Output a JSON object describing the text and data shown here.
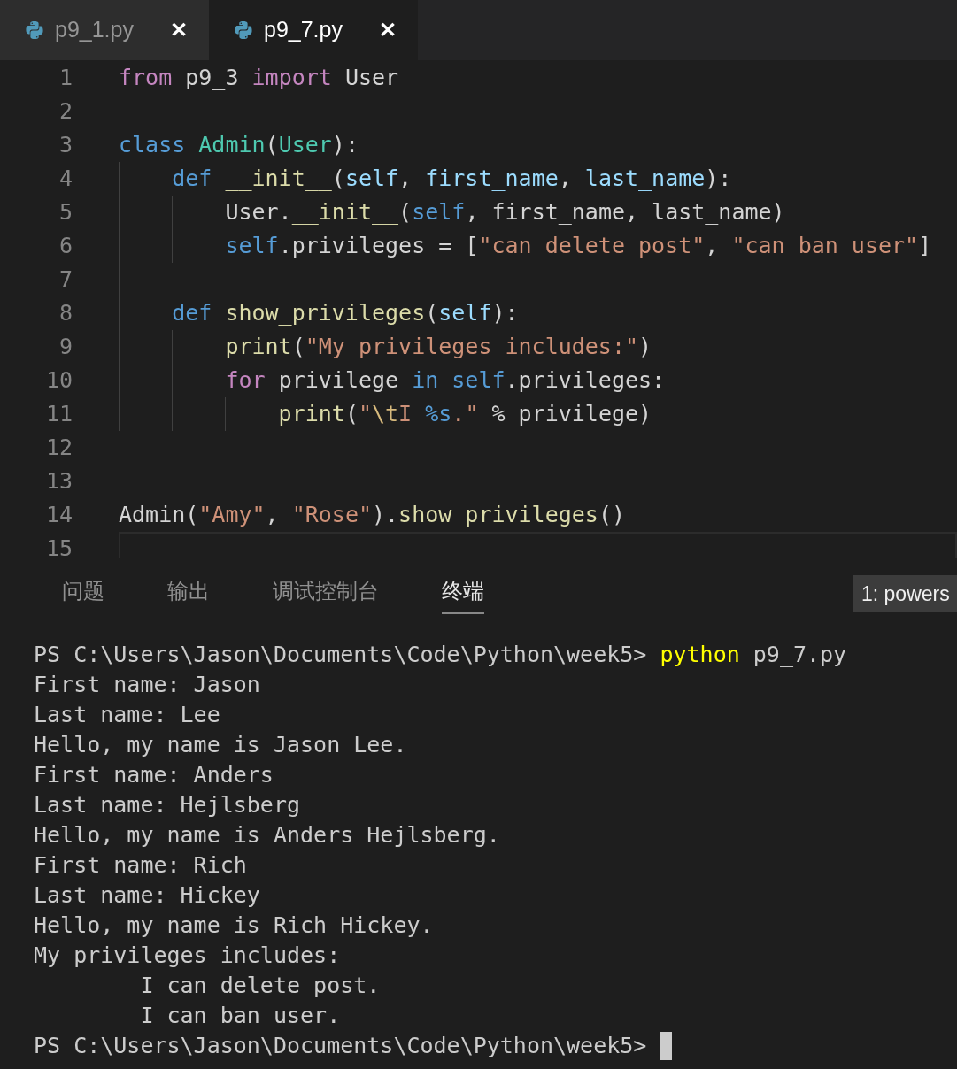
{
  "tabs": [
    {
      "label": "p9_1.py",
      "selected": false,
      "close": "✕"
    },
    {
      "label": "p9_7.py",
      "selected": true,
      "close": "✕"
    }
  ],
  "editor": {
    "lines": [
      {
        "number": "1",
        "tokens": [
          {
            "kind": "keyword",
            "text": "from"
          },
          {
            "kind": "plain",
            "text": " p9_3 "
          },
          {
            "kind": "keyword",
            "text": "import"
          },
          {
            "kind": "plain",
            "text": " User"
          }
        ]
      },
      {
        "number": "2"
      },
      {
        "number": "3",
        "tokens": [
          {
            "kind": "storage",
            "text": "class"
          },
          {
            "kind": "class",
            "text": " Admin"
          },
          {
            "kind": "plain",
            "text": "("
          },
          {
            "kind": "class",
            "text": "User"
          },
          {
            "kind": "plain",
            "text": "):"
          }
        ]
      },
      {
        "number": "4",
        "tokens": [
          {
            "kind": "storage",
            "text": "    def"
          },
          {
            "kind": "function",
            "text": " __init__"
          },
          {
            "kind": "plain",
            "text": "("
          },
          {
            "kind": "param",
            "text": "self"
          },
          {
            "kind": "plain",
            "text": ", "
          },
          {
            "kind": "param",
            "text": "first_name"
          },
          {
            "kind": "plain",
            "text": ", "
          },
          {
            "kind": "param",
            "text": "last_name"
          },
          {
            "kind": "plain",
            "text": "):"
          }
        ]
      },
      {
        "number": "5",
        "tokens": [
          {
            "kind": "plain",
            "text": "        User."
          },
          {
            "kind": "function",
            "text": "__init__"
          },
          {
            "kind": "plain",
            "text": "("
          },
          {
            "kind": "storage",
            "text": "self"
          },
          {
            "kind": "plain",
            "text": ", first_name, last_name)"
          }
        ]
      },
      {
        "number": "6",
        "tokens": [
          {
            "kind": "storage",
            "text": "        self"
          },
          {
            "kind": "plain",
            "text": ".privileges = ["
          },
          {
            "kind": "string",
            "text": "\"can delete post\""
          },
          {
            "kind": "plain",
            "text": ", "
          },
          {
            "kind": "string",
            "text": "\"can ban user\""
          },
          {
            "kind": "plain",
            "text": "]"
          }
        ]
      },
      {
        "number": "7"
      },
      {
        "number": "8",
        "tokens": [
          {
            "kind": "storage",
            "text": "    def"
          },
          {
            "kind": "function",
            "text": " show_privileges"
          },
          {
            "kind": "plain",
            "text": "("
          },
          {
            "kind": "param",
            "text": "self"
          },
          {
            "kind": "plain",
            "text": "):"
          }
        ]
      },
      {
        "number": "9",
        "tokens": [
          {
            "kind": "function",
            "text": "        print"
          },
          {
            "kind": "plain",
            "text": "("
          },
          {
            "kind": "string",
            "text": "\"My privileges includes:\""
          },
          {
            "kind": "plain",
            "text": ")"
          }
        ]
      },
      {
        "number": "10",
        "tokens": [
          {
            "kind": "keyword",
            "text": "        for"
          },
          {
            "kind": "plain",
            "text": " privilege "
          },
          {
            "kind": "storage",
            "text": "in self"
          },
          {
            "kind": "plain",
            "text": ".privileges:"
          }
        ]
      },
      {
        "number": "11",
        "tokens": [
          {
            "kind": "function",
            "text": "            print"
          },
          {
            "kind": "plain",
            "text": "("
          },
          {
            "kind": "string",
            "text": "\""
          },
          {
            "kind": "escape",
            "text": "\\t"
          },
          {
            "kind": "string",
            "text": "I "
          },
          {
            "kind": "storage",
            "text": "%s"
          },
          {
            "kind": "string",
            "text": ".\""
          },
          {
            "kind": "plain",
            "text": " % privilege)"
          }
        ]
      },
      {
        "number": "12"
      },
      {
        "number": "13"
      },
      {
        "number": "14",
        "tokens": [
          {
            "kind": "plain",
            "text": "Admin("
          },
          {
            "kind": "string",
            "text": "\"Amy\""
          },
          {
            "kind": "plain",
            "text": ", "
          },
          {
            "kind": "string",
            "text": "\"Rose\""
          },
          {
            "kind": "plain",
            "text": ")."
          },
          {
            "kind": "function",
            "text": "show_privileges"
          },
          {
            "kind": "plain",
            "text": "()"
          }
        ]
      },
      {
        "number": "15",
        "current": true
      }
    ]
  },
  "panel": {
    "tabs": [
      {
        "label": "问题",
        "selected": false
      },
      {
        "label": "输出",
        "selected": false
      },
      {
        "label": "调试控制台",
        "selected": false
      },
      {
        "label": "终端",
        "selected": true
      }
    ],
    "terminal_select": "1: powers",
    "terminal": [
      [
        {
          "kind": "plain",
          "text": "PS C:\\Users\\Jason\\Documents\\Code\\Python\\week5> "
        },
        {
          "kind": "command",
          "text": "python"
        },
        {
          "kind": "plain",
          "text": " p9_7.py"
        }
      ],
      [
        {
          "kind": "plain",
          "text": "First name: Jason"
        }
      ],
      [
        {
          "kind": "plain",
          "text": "Last name: Lee"
        }
      ],
      [
        {
          "kind": "plain",
          "text": "Hello, my name is Jason Lee."
        }
      ],
      [
        {
          "kind": "plain",
          "text": "First name: Anders"
        }
      ],
      [
        {
          "kind": "plain",
          "text": "Last name: Hejlsberg"
        }
      ],
      [
        {
          "kind": "plain",
          "text": "Hello, my name is Anders Hejlsberg."
        }
      ],
      [
        {
          "kind": "plain",
          "text": "First name: Rich"
        }
      ],
      [
        {
          "kind": "plain",
          "text": "Last name: Hickey"
        }
      ],
      [
        {
          "kind": "plain",
          "text": "Hello, my name is Rich Hickey."
        }
      ],
      [
        {
          "kind": "plain",
          "text": "My privileges includes:"
        }
      ],
      [
        {
          "kind": "plain",
          "text": "        I can delete post."
        }
      ],
      [
        {
          "kind": "plain",
          "text": "        I can ban user."
        }
      ],
      [
        {
          "kind": "plain",
          "text": "PS C:\\Users\\Jason\\Documents\\Code\\Python\\week5> "
        },
        {
          "kind": "cursor"
        }
      ]
    ]
  }
}
